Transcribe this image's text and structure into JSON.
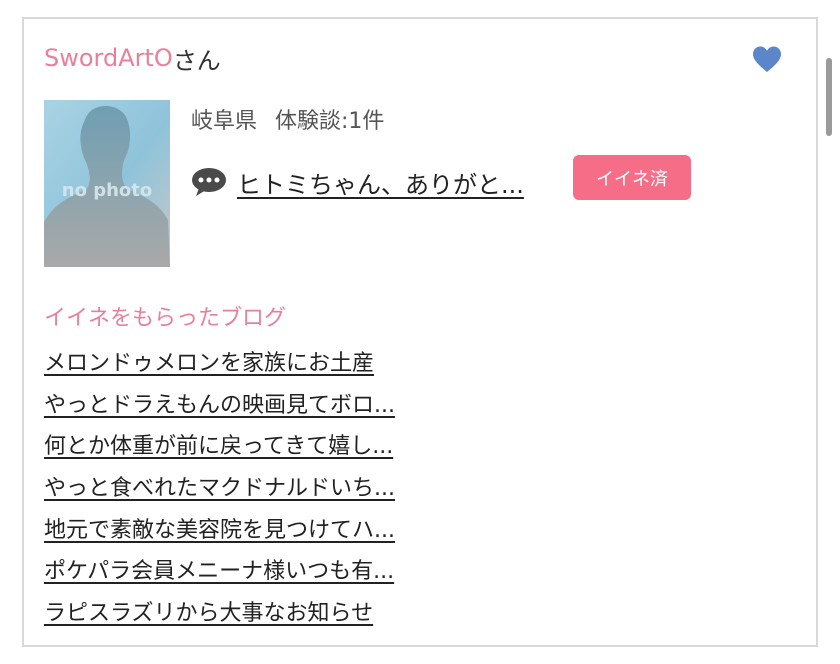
{
  "user": {
    "name": "SwordArtO",
    "honorific": "さん",
    "prefecture": "岐阜県",
    "reviews_count": "体験談:1件",
    "avatar_label": "no photo",
    "favorite_icon": "heart-icon",
    "favorite_color": "#5b86c9"
  },
  "review": {
    "icon": "speech-bubble-icon",
    "title": "ヒトミちゃん、ありがと...",
    "like_button_label": "イイネ済",
    "like_button_color": "#f56d86"
  },
  "blogs": {
    "heading": "イイネをもらったブログ",
    "items": [
      "メロンドゥメロンを家族にお土産",
      "やっとドラえもんの映画見てボロ...",
      "何とか体重が前に戻ってきて嬉し...",
      "やっと食べれたマクドナルドいち...",
      "地元で素敵な美容院を見つけてハ...",
      "ポケパラ会員メニーナ様いつも有...",
      "ラピスラズリから大事なお知らせ"
    ]
  },
  "colors": {
    "accent_pink": "#e8809c",
    "border": "#d9d9d9"
  }
}
